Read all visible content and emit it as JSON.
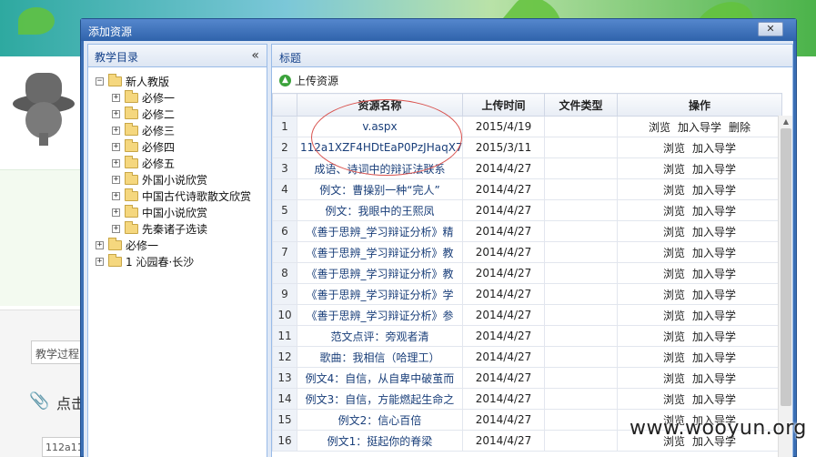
{
  "background": {
    "input_text": "教学过程",
    "clip_label": "点击",
    "input2_text": "112a11"
  },
  "dialog": {
    "title": "添加资源",
    "close_label": "✕",
    "tree": {
      "header": "教学目录",
      "collapse_icon": "«",
      "root": "新人教版",
      "children": [
        "必修一",
        "必修二",
        "必修三",
        "必修四",
        "必修五",
        "外国小说欣赏",
        "中国古代诗歌散文欣赏",
        "中国小说欣赏",
        "先秦诸子选读"
      ],
      "others": [
        "必修一",
        "1 沁园春·长沙"
      ]
    },
    "grid": {
      "header": "标题",
      "upload_label": "上传资源",
      "columns": [
        "",
        "资源名称",
        "上传时间",
        "文件类型",
        "操作"
      ],
      "rows": [
        {
          "n": "1",
          "name": "v.aspx",
          "time": "2015/4/19",
          "type": "",
          "ops": [
            "浏览",
            "加入导学",
            "删除"
          ]
        },
        {
          "n": "2",
          "name": "112a1XZF4HDtEaP0PzJHaqX7",
          "time": "2015/3/11",
          "type": "",
          "ops": [
            "浏览",
            "加入导学"
          ]
        },
        {
          "n": "3",
          "name": "成语、诗词中的辩证法联系",
          "time": "2014/4/27",
          "type": "",
          "ops": [
            "浏览",
            "加入导学"
          ]
        },
        {
          "n": "4",
          "name": "例文：曹操别一种“完人”",
          "time": "2014/4/27",
          "type": "",
          "ops": [
            "浏览",
            "加入导学"
          ]
        },
        {
          "n": "5",
          "name": "例文：我眼中的王熙凤",
          "time": "2014/4/27",
          "type": "",
          "ops": [
            "浏览",
            "加入导学"
          ]
        },
        {
          "n": "6",
          "name": "《善于思辨_学习辩证分析》精",
          "time": "2014/4/27",
          "type": "",
          "ops": [
            "浏览",
            "加入导学"
          ]
        },
        {
          "n": "7",
          "name": "《善于思辨_学习辩证分析》教",
          "time": "2014/4/27",
          "type": "",
          "ops": [
            "浏览",
            "加入导学"
          ]
        },
        {
          "n": "8",
          "name": "《善于思辨_学习辩证分析》教",
          "time": "2014/4/27",
          "type": "",
          "ops": [
            "浏览",
            "加入导学"
          ]
        },
        {
          "n": "9",
          "name": "《善于思辨_学习辩证分析》学",
          "time": "2014/4/27",
          "type": "",
          "ops": [
            "浏览",
            "加入导学"
          ]
        },
        {
          "n": "10",
          "name": "《善于思辨_学习辩证分析》参",
          "time": "2014/4/27",
          "type": "",
          "ops": [
            "浏览",
            "加入导学"
          ]
        },
        {
          "n": "11",
          "name": "范文点评：旁观者清",
          "time": "2014/4/27",
          "type": "",
          "ops": [
            "浏览",
            "加入导学"
          ]
        },
        {
          "n": "12",
          "name": "歌曲：我相信（哈理工）",
          "time": "2014/4/27",
          "type": "",
          "ops": [
            "浏览",
            "加入导学"
          ]
        },
        {
          "n": "13",
          "name": "例文4：自信，从自卑中破茧而",
          "time": "2014/4/27",
          "type": "",
          "ops": [
            "浏览",
            "加入导学"
          ]
        },
        {
          "n": "14",
          "name": "例文3：自信，方能燃起生命之",
          "time": "2014/4/27",
          "type": "",
          "ops": [
            "浏览",
            "加入导学"
          ]
        },
        {
          "n": "15",
          "name": "例文2：信心百倍",
          "time": "2014/4/27",
          "type": "",
          "ops": [
            "浏览",
            "加入导学"
          ]
        },
        {
          "n": "16",
          "name": "例文1：挺起你的脊梁",
          "time": "2014/4/27",
          "type": "",
          "ops": [
            "浏览",
            "加入导学"
          ]
        }
      ]
    }
  },
  "watermark": "www.wooyun.org",
  "colors": {
    "dialog_frame": "#3b6fb5",
    "header_text": "#15428b",
    "highlight_ellipse": "#d9534f"
  }
}
